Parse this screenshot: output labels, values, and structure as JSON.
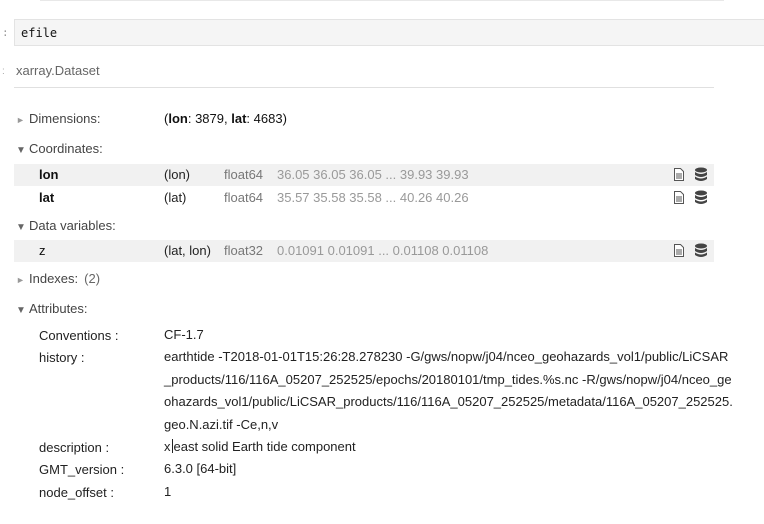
{
  "notebook": {
    "input_code": "efile",
    "prompt_glyph": ":"
  },
  "dataset": {
    "title": "xarray.Dataset",
    "sections": {
      "dimensions_label": "Dimensions:",
      "coordinates_label": "Coordinates:",
      "data_variables_label": "Data variables:",
      "indexes_label": "Indexes:",
      "indexes_count": "(2)",
      "attributes_label": "Attributes:"
    },
    "dimensions": {
      "open": "(",
      "lon_name": "lon",
      "lon_sep": ": ",
      "lon_size": "3879",
      "comma": ", ",
      "lat_name": "lat",
      "lat_sep": ": ",
      "lat_size": "4683",
      "close": ")"
    },
    "coordinates": [
      {
        "name": "lon",
        "dims": "(lon)",
        "dtype": "float64",
        "preview": "36.05 36.05 36.05 ... 39.93 39.93"
      },
      {
        "name": "lat",
        "dims": "(lat)",
        "dtype": "float64",
        "preview": "35.57 35.58 35.58 ... 40.26 40.26"
      }
    ],
    "data_variables": [
      {
        "name": "z",
        "dims": "(lat, lon)",
        "dtype": "float32",
        "preview": "0.01091 0.01091 ... 0.01108 0.01108"
      }
    ],
    "attributes": {
      "conventions_key": "Conventions :",
      "conventions_val": "CF-1.7",
      "history_key": "history :",
      "history_val": "earthtide -T2018-01-01T15:26:28.278230 -G/gws/nopw/j04/nceo_geohazards_vol1/public/LiCSAR_products/116/116A_05207_252525/epochs/20180101/tmp_tides.%s.nc -R/gws/nopw/j04/nceo_geohazards_vol1/public/LiCSAR_products/116/116A_05207_252525/metadata/116A_05207_252525.geo.N.azi.tif -Ce,n,v",
      "description_key": "description :",
      "description_val_pre": "x",
      "description_val_post": "east solid Earth tide component",
      "gmt_version_key": "GMT_version :",
      "gmt_version_val": "6.3.0 [64-bit]",
      "node_offset_key": "node_offset :",
      "node_offset_val": "1"
    }
  },
  "icons": {
    "attrs": "file-text-icon",
    "data": "database-icon",
    "expanded": "triangle-down-icon",
    "collapsed": "triangle-right-icon"
  },
  "colors": {
    "row_shade": "#f1f1f1",
    "input_bg": "#f5f5f5"
  }
}
